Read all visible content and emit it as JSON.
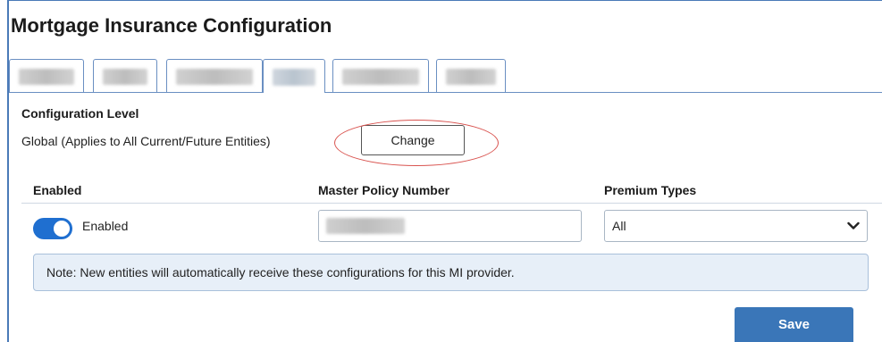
{
  "page": {
    "title": "Mortgage Insurance Configuration"
  },
  "tabs": [
    {
      "label": "",
      "redacted": true,
      "active": false
    },
    {
      "label": "",
      "redacted": true,
      "active": false
    },
    {
      "label": "",
      "redacted": true,
      "active": false
    },
    {
      "label": "",
      "redacted": true,
      "active": true
    },
    {
      "label": "",
      "redacted": true,
      "active": false
    },
    {
      "label": "",
      "redacted": true,
      "active": false
    }
  ],
  "config_level": {
    "heading": "Configuration Level",
    "description": "Global (Applies to All Current/Future Entities)",
    "change_label": "Change"
  },
  "table": {
    "headers": {
      "enabled": "Enabled",
      "master_policy": "Master Policy Number",
      "premium_types": "Premium Types"
    },
    "row": {
      "enabled_state": true,
      "enabled_label": "Enabled",
      "master_policy_value": "",
      "premium_type_selected": "All"
    }
  },
  "note": "Note: New entities will automatically receive these configurations for this MI provider.",
  "actions": {
    "save_label": "Save"
  },
  "colors": {
    "accent": "#1f6fd0",
    "save_button": "#3a76b8",
    "note_bg": "#e7eff8",
    "highlight": "#d9534f"
  }
}
